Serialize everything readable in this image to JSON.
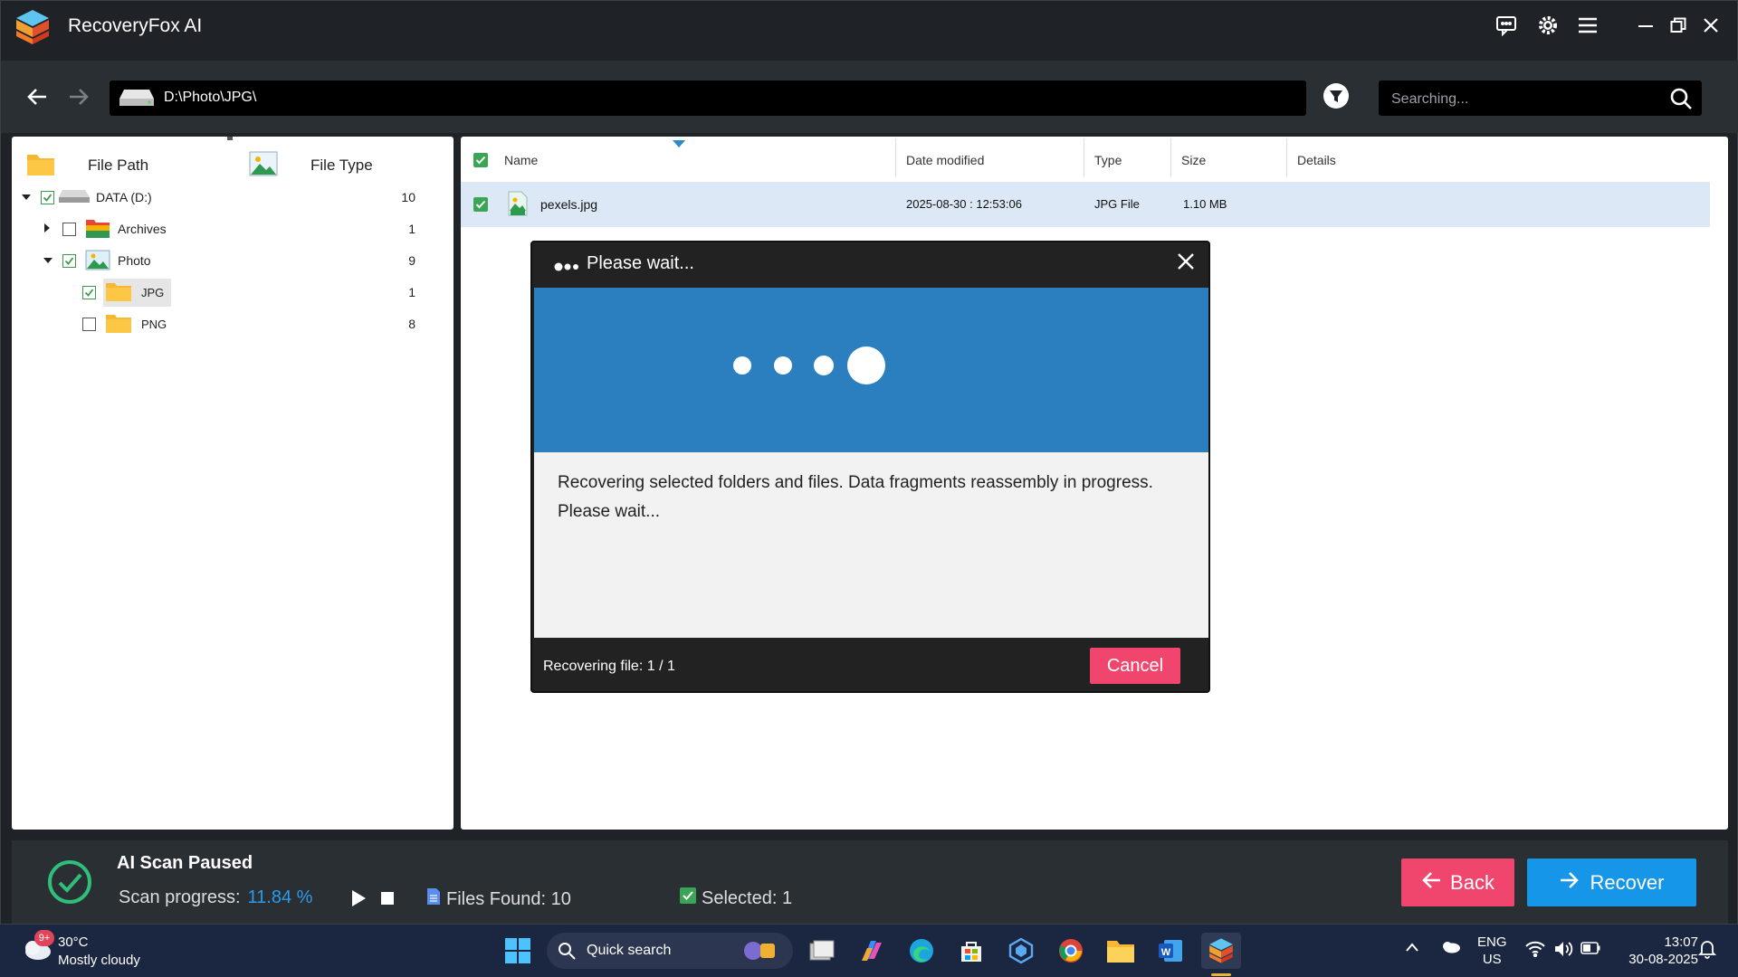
{
  "app": {
    "title": "RecoveryFox AI"
  },
  "toolbar": {
    "path": "D:\\Photo\\JPG\\",
    "search_placeholder": "Searching..."
  },
  "left_panel": {
    "tabs": [
      {
        "label": "File Path"
      },
      {
        "label": "File Type"
      }
    ],
    "tree": [
      {
        "label": "DATA (D:)",
        "count": "10",
        "checked": true,
        "expanded": true
      },
      {
        "label": "Archives",
        "count": "1",
        "checked": false,
        "expanded": false
      },
      {
        "label": "Photo",
        "count": "9",
        "checked": true,
        "expanded": true
      },
      {
        "label": "JPG",
        "count": "1",
        "checked": true
      },
      {
        "label": "PNG",
        "count": "8",
        "checked": false
      }
    ]
  },
  "file_table": {
    "columns": [
      "Name",
      "Date modified",
      "Type",
      "Size",
      "Details"
    ],
    "rows": [
      {
        "name": "pexels.jpg",
        "date": "2025-08-30 : 12:53:06",
        "type": "JPG File",
        "size": "1.10 MB",
        "details": ""
      }
    ]
  },
  "dialog": {
    "title": "Please wait...",
    "message": "Recovering selected folders and files. Data fragments reassembly in progress. Please wait...",
    "progress_text": "Recovering file:  1 / 1",
    "cancel_label": "Cancel"
  },
  "status": {
    "title": "AI Scan Paused",
    "progress_label": "Scan progress:",
    "progress_value": "11.84 %",
    "files_found": "Files Found: 10",
    "selected": "Selected: 1",
    "back_label": "Back",
    "recover_label": "Recover"
  },
  "taskbar": {
    "weather_badge": "9+",
    "weather_temp": "30°C",
    "weather_desc": "Mostly cloudy",
    "search_label": "Quick search",
    "lang_1": "ENG",
    "lang_2": "US",
    "time": "13:07",
    "date": "30-08-2025"
  },
  "colors": {
    "accent_blue": "#1596e8",
    "accent_pink": "#f0466e",
    "banner_blue": "#2b7fbf",
    "check_green": "#3a9a4a"
  }
}
